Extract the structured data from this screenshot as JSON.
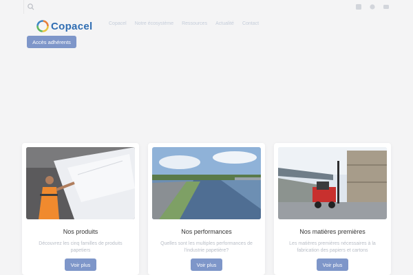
{
  "header": {
    "logo_text": "Copacel",
    "nav_items": [
      "Copacel",
      "Notre écosystème",
      "Ressources",
      "Actualité",
      "Contact"
    ],
    "adherents_button": "Accès adhérents"
  },
  "cards": [
    {
      "title": "Nos produits",
      "description": "Découvrez les cinq familles de produits papetiers",
      "button": "Voir plus"
    },
    {
      "title": "Nos performances",
      "description": "Quelles sont les multiples performances de l'industrie papetière?",
      "button": "Voir plus"
    },
    {
      "title": "Nos matières premières",
      "description": "Les matières premières nécessaires à la fabrication des papiers et cartons",
      "button": "Voir plus"
    }
  ],
  "colors": {
    "accent": "#7e96c9",
    "logo_blue": "#2f6db2",
    "background": "#f4f4f5"
  }
}
